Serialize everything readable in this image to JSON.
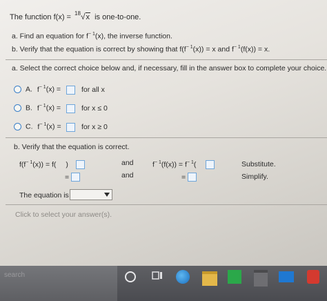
{
  "question": {
    "intro": "The function f(x) =",
    "root_index": "18",
    "root_radicand": "x",
    "intro_end": "is one-to-one.",
    "part_a_line": "a. Find an equation for f",
    "part_a_sup": "− 1",
    "part_a_end": "(x), the inverse function.",
    "part_b_line": "b. Verify that the equation is correct by showing that f(f",
    "part_b_sup": "− 1",
    "part_b_mid": "(x)) = x and f",
    "part_b_sup2": "− 1",
    "part_b_end": "(f(x)) = x."
  },
  "part_a": {
    "instruction": "a. Select the correct choice below and, if necessary, fill in the answer box to complete your choice.",
    "choices": [
      {
        "letter": "A.",
        "func": "f",
        "sup": "− 1",
        "arg": "(x) =",
        "condition": "for all x"
      },
      {
        "letter": "B.",
        "func": "f",
        "sup": "− 1",
        "arg": "(x) =",
        "condition": "for x ≤ 0"
      },
      {
        "letter": "C.",
        "func": "f",
        "sup": "− 1",
        "arg": "(x) =",
        "condition": "for x ≥ 0"
      }
    ]
  },
  "part_b": {
    "instruction": "b. Verify that the equation is correct.",
    "left_expr": "f(f",
    "left_sup": "− 1",
    "left_rest": "(x)) = f(",
    "left_close": ")",
    "and_1": "and",
    "and_2": "and",
    "right_expr": "f",
    "right_sup": "− 1",
    "right_mid": "(f(x)) = f",
    "right_sup2": "− 1",
    "right_open": "(",
    "right_close": ")",
    "eq_1": "=",
    "eq_2": "=",
    "substitute": "Substitute.",
    "simplify": "Simplify.",
    "equation_is_label": "The equation is",
    "hint": "Click to select your answer(s)."
  },
  "taskbar": {
    "search_text": "search"
  }
}
